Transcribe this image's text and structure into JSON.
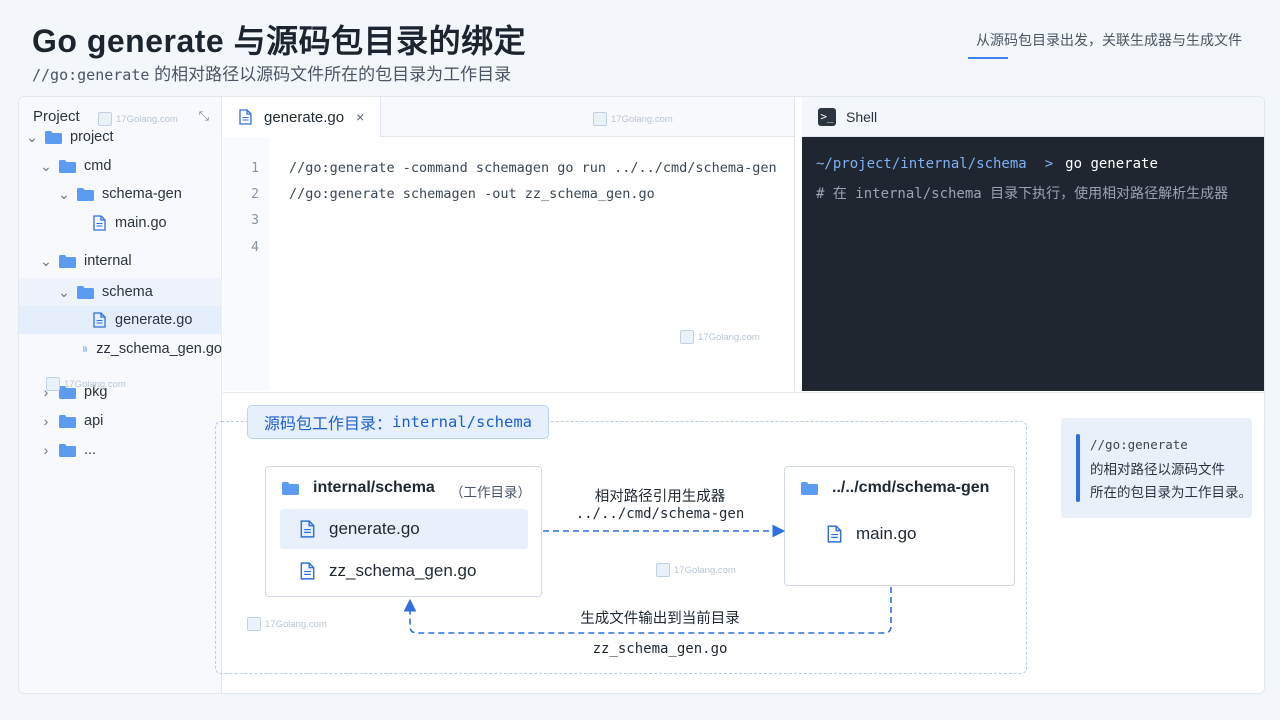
{
  "header": {
    "title": "Go generate 与源码包目录的绑定",
    "subtitle_code": "//go:generate",
    "subtitle_text": " 的相对路径以源码文件所在的包目录为工作目录",
    "top_right": "从源码包目录出发，关联生成器与生成文件"
  },
  "colors": {
    "accent": "#2f6fe0",
    "folder": "#5b9cf0",
    "terminal_bg": "#1f2630",
    "prompt": "#7fb1f5"
  },
  "sidebar": {
    "title": "Project",
    "collapse_glyph": "⤡",
    "tree": [
      {
        "label": "project",
        "type": "folder",
        "depth": 0,
        "expanded": true
      },
      {
        "label": "cmd",
        "type": "folder",
        "depth": 1,
        "expanded": true
      },
      {
        "label": "schema-gen",
        "type": "folder",
        "depth": 2,
        "expanded": true
      },
      {
        "label": "main.go",
        "type": "file",
        "depth": 3
      },
      {
        "label": "internal",
        "type": "folder",
        "depth": 1,
        "expanded": true
      },
      {
        "label": "schema",
        "type": "folder",
        "depth": 2,
        "expanded": true,
        "selected": "light"
      },
      {
        "label": "generate.go",
        "type": "file",
        "depth": 3,
        "selected": "active"
      },
      {
        "label": "zz_schema_gen.go",
        "type": "file",
        "depth": 3
      },
      {
        "label": "pkg",
        "type": "folder",
        "depth": 1,
        "expanded": false
      },
      {
        "label": "api",
        "type": "folder",
        "depth": 1,
        "expanded": false
      },
      {
        "label": "...",
        "type": "folder",
        "depth": 1,
        "expanded": false
      }
    ]
  },
  "editor": {
    "tab_label": "generate.go",
    "close_glyph": "×",
    "line_numbers": [
      "1",
      "2",
      "3",
      "4"
    ],
    "lines": [
      "//go:generate -command schemagen go run ../../cmd/schema-gen",
      "//go:generate schemagen -out zz_schema_gen.go",
      "",
      ""
    ]
  },
  "shell": {
    "title": "Shell",
    "icon_glyph": ">_",
    "prompt_path": "~/project/internal/schema",
    "prompt_arrow": ">",
    "command": "go generate",
    "comment": "# 在 internal/schema 目录下执行，使用相对路径解析生成器"
  },
  "diagram": {
    "group_label_text": "源码包工作目录：",
    "group_label_code": "internal/schema",
    "source_box": {
      "title": "internal/schema",
      "tag": "（工作目录）",
      "files": [
        "generate.go",
        "zz_schema_gen.go"
      ]
    },
    "target_box": {
      "title": "../../cmd/schema-gen",
      "files": [
        "main.go"
      ]
    },
    "arrow_ref_label": "相对路径引用生成器",
    "arrow_ref_path": "../../cmd/schema-gen",
    "arrow_out_label": "生成文件输出到当前目录",
    "arrow_out_file": "zz_schema_gen.go"
  },
  "note": {
    "code": "//go:generate",
    "line2": "的相对路径以源码文件",
    "line3": "所在的包目录为工作目录。"
  },
  "watermark": "17Golang.com"
}
